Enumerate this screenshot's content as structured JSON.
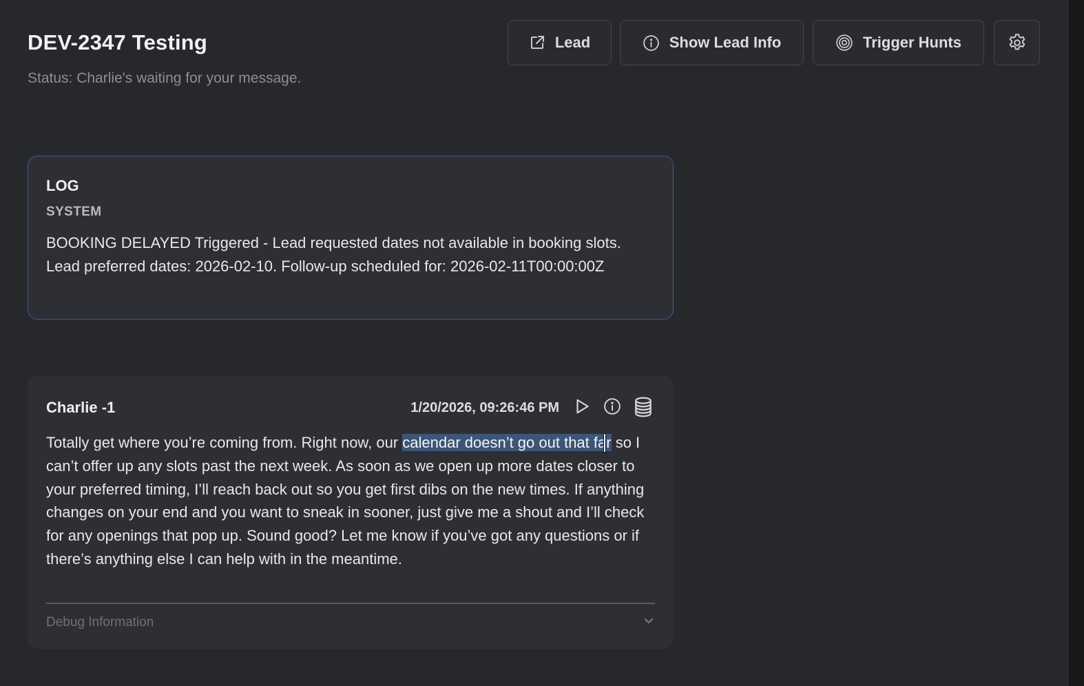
{
  "header": {
    "title": "DEV-2347 Testing",
    "status": "Status: Charlie's waiting for your message."
  },
  "toolbar": {
    "lead_label": "Lead",
    "lead_icon": "external-link-icon",
    "show_info_label": "Show Lead Info",
    "show_info_icon": "info-icon",
    "trigger_hunts_label": "Trigger Hunts",
    "trigger_hunts_icon": "target-icon",
    "settings_icon": "gear-icon"
  },
  "log": {
    "label": "LOG",
    "source": "SYSTEM",
    "text": "BOOKING DELAYED Triggered - Lead requested dates not available in booking slots. Lead preferred dates: 2026-02-10. Follow-up scheduled for: 2026-02-11T00:00:00Z"
  },
  "message": {
    "sender": "Charlie -1",
    "timestamp": "1/20/2026, 09:26:46 PM",
    "icons": [
      "play-icon",
      "info-icon",
      "database-icon"
    ],
    "body_before": "Totally get where you’re coming from. Right now, our ",
    "body_highlight_1": "calendar doesn’t go out that fa",
    "body_highlight_2": "r",
    "body_after": " so I can’t offer up any slots past the next week. As soon as we open up more dates closer to your preferred timing, I’ll reach back out so you get first dibs on the new times. If anything changes on your end and you want to sneak in sooner, just give me a shout and I’ll check for any openings that pop up. Sound good? Let me know if you’ve got any questions or if there’s anything else I can help with in the meantime.",
    "debug_label": "Debug Information"
  },
  "colors": {
    "background": "#27282c",
    "card": "#2e2f34",
    "log_border": "#3c5a96",
    "selection": "#3d5577"
  }
}
